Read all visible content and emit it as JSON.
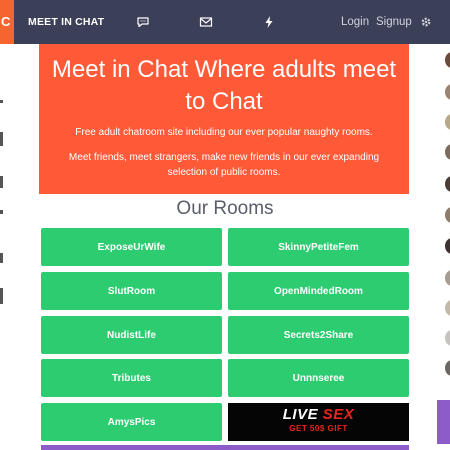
{
  "navbar": {
    "edge_glyph": "C",
    "brand": "MEET IN CHAT",
    "icons": [
      "chat-icon",
      "mail-icon",
      "lightning-icon"
    ],
    "login_label": "Login",
    "signup_label": "Signup",
    "settings_icon": "gear-icon"
  },
  "hero": {
    "title": "Meet in Chat Where adults meet to Chat",
    "line1": "Free adult chatroom site including our ever popular naughty rooms.",
    "line2": "Meet friends, meet strangers, make new friends in our ever expanding selection of public rooms."
  },
  "rooms": {
    "heading": "Our Rooms",
    "items": [
      "ExposeUrWife",
      "SkinnyPetiteFem",
      "SlutRoom",
      "OpenMindedRoom",
      "NudistLife",
      "Secrets2Share",
      "Tributes",
      "Unnnseree",
      "AmysPics"
    ]
  },
  "ad": {
    "title_part1": "LIVE ",
    "title_part2": "SEX",
    "subtitle": "GET 50$ GIFT"
  },
  "colors": {
    "navbar": "#3b3f57",
    "accent": "#ff5a38",
    "room_button": "#2ecc71",
    "purple": "#8e5cc8"
  }
}
